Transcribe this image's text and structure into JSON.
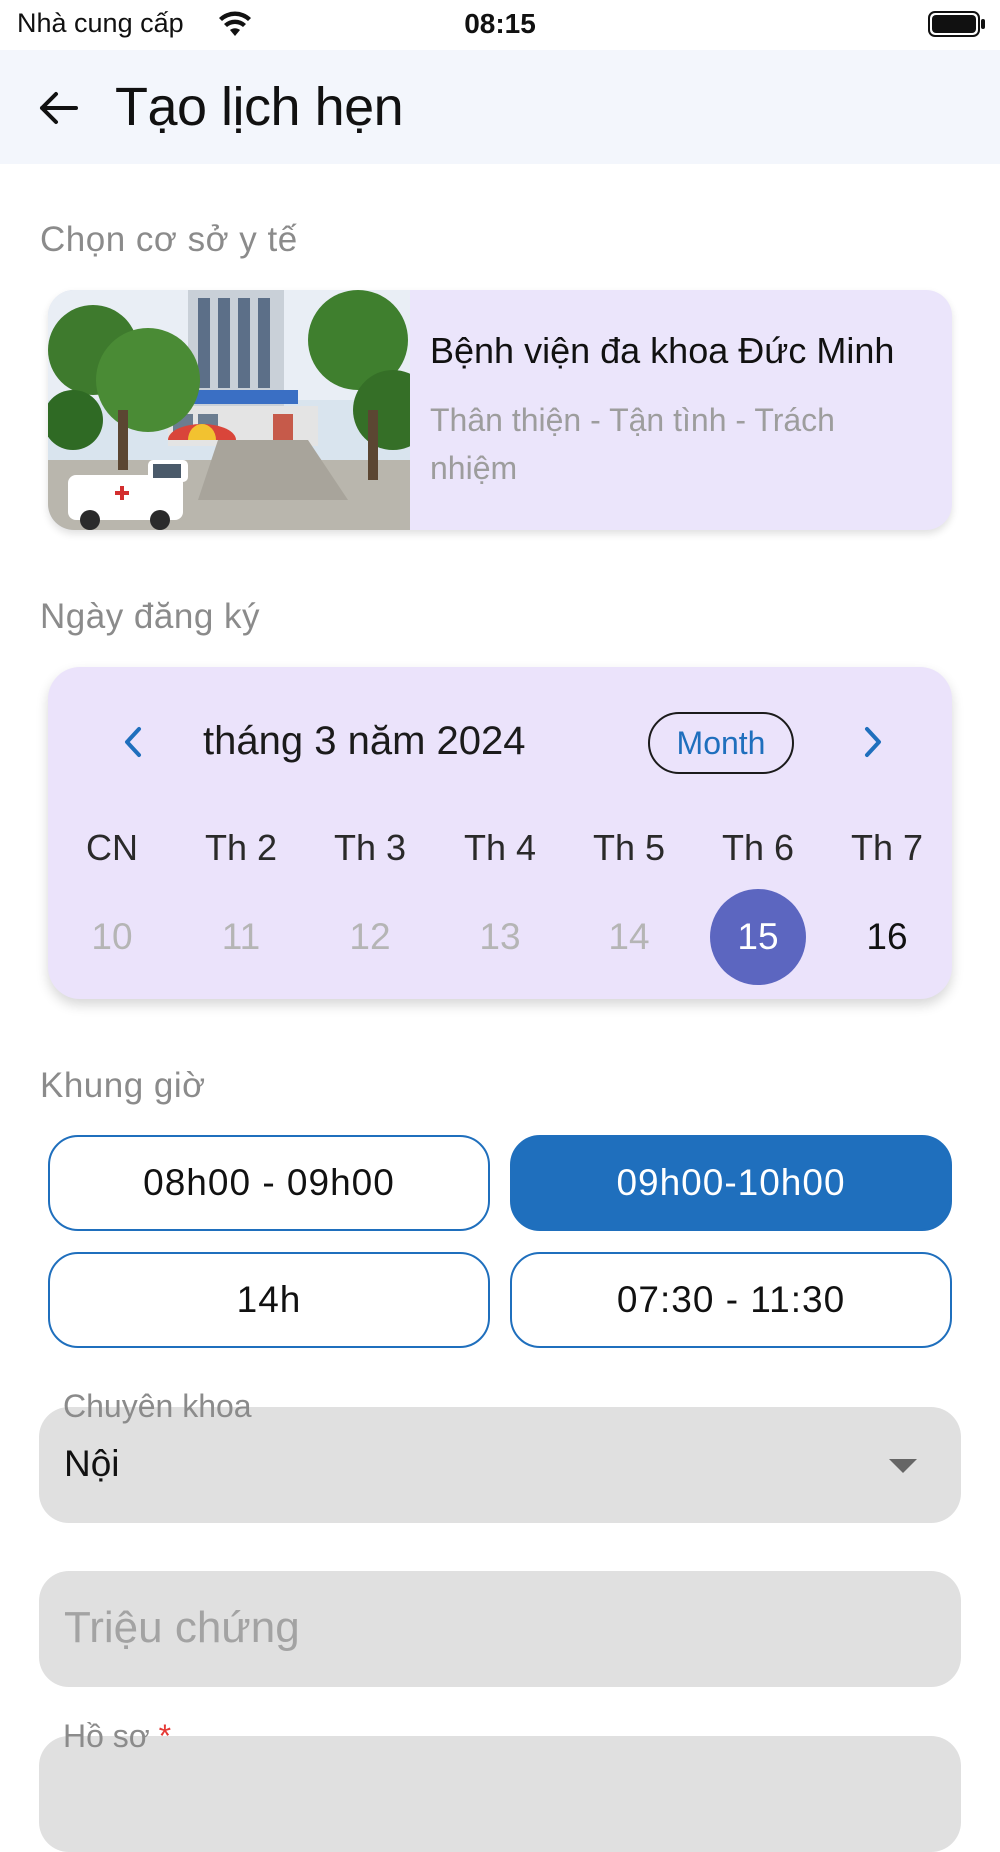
{
  "status_bar": {
    "carrier": "Nhà cung cấp",
    "time": "08:15"
  },
  "app_bar": {
    "title": "Tạo lịch hẹn",
    "back_icon": "arrow-left-icon"
  },
  "facility_section": {
    "label": "Chọn cơ sở y tế",
    "hospital": {
      "name": "Bệnh viện đa khoa Đức Minh",
      "slogan": "Thân thiện - Tận tình - Trách nhiệm"
    }
  },
  "date_section": {
    "label": "Ngày đăng ký",
    "calendar": {
      "month_title": "tháng 3 năm 2024",
      "format_button": "Month",
      "weekdays": [
        "CN",
        "Th 2",
        "Th 3",
        "Th 4",
        "Th 5",
        "Th 6",
        "Th 7"
      ],
      "days": [
        "10",
        "11",
        "12",
        "13",
        "14",
        "15",
        "16"
      ],
      "selected_day": "15",
      "accent_color": "#5c66c0"
    }
  },
  "time_section": {
    "label": "Khung giờ",
    "slots": [
      {
        "label": "08h00 - 09h00",
        "selected": false
      },
      {
        "label": "09h00-10h00",
        "selected": true
      },
      {
        "label": "14h",
        "selected": false
      },
      {
        "label": "07:30 - 11:30",
        "selected": false
      }
    ],
    "accent_color": "#1f6fbd"
  },
  "specialty_field": {
    "label": "Chuyên khoa",
    "value": "Nội"
  },
  "symptoms_field": {
    "placeholder": "Triệu chứng"
  },
  "profile_field": {
    "label": "Hồ sơ",
    "required_mark": "*"
  }
}
